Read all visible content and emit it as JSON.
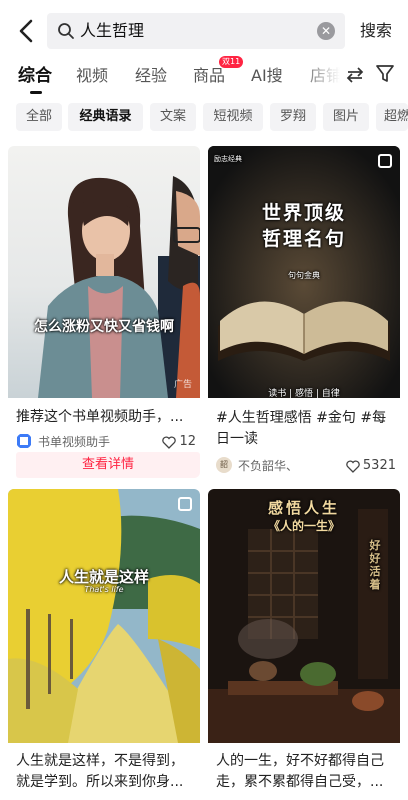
{
  "header": {
    "search_query": "人生哲理",
    "search_button": "搜索"
  },
  "tabs": [
    {
      "label": "综合",
      "active": true
    },
    {
      "label": "视频"
    },
    {
      "label": "经验"
    },
    {
      "label": "商品",
      "badge": "双11"
    },
    {
      "label": "AI搜"
    },
    {
      "label": "店铺"
    }
  ],
  "chips": [
    {
      "label": "全部"
    },
    {
      "label": "经典语录",
      "active": true
    },
    {
      "label": "文案"
    },
    {
      "label": "短视频"
    },
    {
      "label": "罗翔"
    },
    {
      "label": "图片"
    },
    {
      "label": "超燃"
    }
  ],
  "cards": [
    {
      "overlay_caption": "怎么涨粉又快又省钱啊",
      "ad_label": "广告",
      "title": "推荐这个书单视频助手，...",
      "author": "书单视频助手",
      "likes": "12",
      "detail_button": "查看详情"
    },
    {
      "corner_label": "励志经典",
      "overlay_title_line1": "世界顶级",
      "overlay_title_line2": "哲理名句",
      "overlay_sub": "句句金典",
      "overlay_footer": "读书 | 感悟 | 自律",
      "title": "#人生哲理感悟 #金句 #每日一读",
      "author": "不负韶华、",
      "avatar_text": "韶",
      "likes": "5321"
    },
    {
      "overlay_caption": "人生就是这样",
      "overlay_sub": "That's life",
      "title": "人生就是这样，不是得到，就是学到。所以来到你身..."
    },
    {
      "overlay_title": "感悟人生",
      "overlay_sub": "《人的一生》",
      "overlay_vertical": "好好活着",
      "title": "人的一生，好不好都得自己走，累不累都得自己受，..."
    }
  ],
  "colors": {
    "accent": "#ff2442",
    "chip_bg": "#f3f3f5",
    "search_bg": "#f1f1f3"
  }
}
